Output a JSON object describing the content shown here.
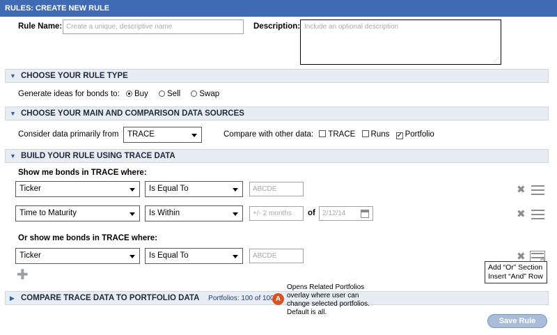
{
  "header": {
    "title": "RULES: CREATE NEW RULE"
  },
  "rule_name": {
    "label": "Rule Name:",
    "placeholder": "Create a unique, descriptive name"
  },
  "description": {
    "label": "Description:",
    "placeholder": "Include an optional description"
  },
  "sections": {
    "rule_type": "CHOOSE YOUR RULE TYPE",
    "data_sources": "CHOOSE YOUR MAIN AND COMPARISON DATA SOURCES",
    "build_rule": "BUILD YOUR RULE USING TRACE DATA",
    "compare": "COMPARE TRACE DATA TO PORTFOLIO DATA"
  },
  "rule_type": {
    "prompt": "Generate ideas for bonds to:",
    "options": [
      "Buy",
      "Sell",
      "Swap"
    ],
    "selected": "Buy"
  },
  "data_sources": {
    "primary_label": "Consider data primarily from",
    "primary_value": "TRACE",
    "compare_label": "Compare with other data:",
    "compare_options": [
      {
        "label": "TRACE",
        "checked": false
      },
      {
        "label": "Runs",
        "checked": false
      },
      {
        "label": "Portfolio",
        "checked": true
      }
    ]
  },
  "build_rule": {
    "group1_label": "Show me bonds in TRACE where:",
    "group2_label": "Or show me bonds in TRACE where:",
    "row1": {
      "field": "Ticker",
      "operator": "Is Equal To",
      "value_placeholder": "ABCDE"
    },
    "row2": {
      "field": "Time to Maturity",
      "operator": "Is Within",
      "value_placeholder": "+/- 2 months",
      "of_label": "of",
      "date_placeholder": "2/12/14"
    },
    "row3": {
      "field": "Ticker",
      "operator": "Is Equal To",
      "value_placeholder": "ABCDE"
    },
    "menu_tooltip": {
      "line1": "Add “Or” Section",
      "line2": "Insert “And” Row"
    }
  },
  "compare": {
    "portfolios_text": "Portfolios: 100 of 100"
  },
  "annotation": {
    "badge": "A",
    "lines": [
      "Opens Related Portfolios",
      "overlay where user can",
      "change selected portfolios.",
      "Default is all."
    ]
  },
  "footer": {
    "save_label": "Save Rule"
  },
  "colors": {
    "header_bg": "#3f6bb5",
    "section_bg": "#e8edf4",
    "badge": "#d9531e",
    "save_button": "#a9bcd9"
  },
  "icons": [
    "chevron-down-icon",
    "chevron-right-icon",
    "remove-icon",
    "menu-icon",
    "add-icon",
    "calendar-icon",
    "pointer-cursor-icon"
  ]
}
